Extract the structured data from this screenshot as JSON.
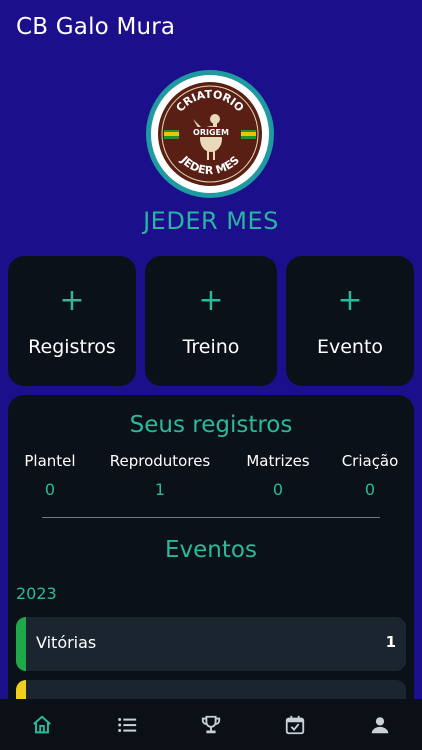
{
  "header": {
    "title": "CB Galo Mura"
  },
  "profile": {
    "name": "JEDER MES",
    "logo": {
      "top_text": "CRIATORIO",
      "center_text": "ORIGEM",
      "bottom_text": "JEDER MES"
    }
  },
  "quick_actions": [
    {
      "icon": "plus-icon",
      "plus": "+",
      "label": "Registros"
    },
    {
      "icon": "plus-icon",
      "plus": "+",
      "label": "Treino"
    },
    {
      "icon": "plus-icon",
      "plus": "+",
      "label": "Evento"
    }
  ],
  "registros": {
    "title": "Seus registros",
    "stats": [
      {
        "label": "Plantel",
        "value": "0"
      },
      {
        "label": "Reprodutores",
        "value": "1"
      },
      {
        "label": "Matrizes",
        "value": "0"
      },
      {
        "label": "Criação",
        "value": "0"
      }
    ]
  },
  "eventos": {
    "title": "Eventos",
    "year": "2023",
    "items": [
      {
        "name": "Vitórias",
        "count": "1",
        "color": "#1fa84a"
      },
      {
        "name": "",
        "count": "",
        "color": "#f2cf1d"
      }
    ]
  },
  "nav": [
    {
      "icon": "home-icon",
      "active": true
    },
    {
      "icon": "list-icon",
      "active": false
    },
    {
      "icon": "trophy-icon",
      "active": false
    },
    {
      "icon": "calendar-check-icon",
      "active": false
    },
    {
      "icon": "person-icon",
      "active": false
    }
  ],
  "colors": {
    "background": "#1c0f8c",
    "accent": "#2cb89b",
    "card": "#0b1118"
  }
}
